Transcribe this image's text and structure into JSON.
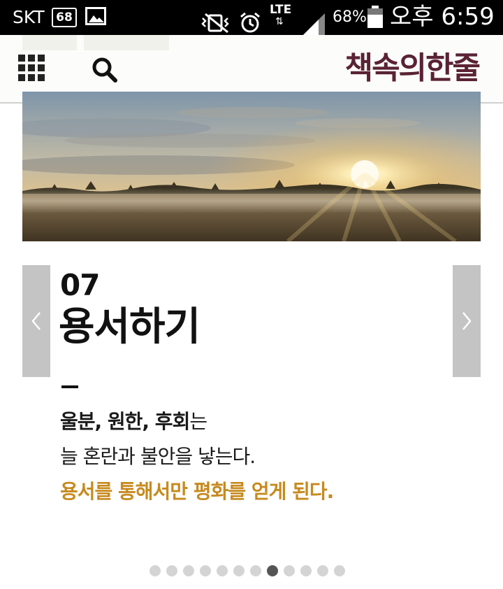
{
  "status_bar": {
    "carrier": "SKT",
    "notification_count": "68",
    "network": "LTE",
    "network_arrows": "⇅",
    "battery": "68%",
    "time": "오후 6:59"
  },
  "header": {
    "brand": "책속의한줄",
    "icons": [
      "grid-menu-icon",
      "search-icon"
    ],
    "brand_color": "#5a2235"
  },
  "slide": {
    "number": "07",
    "title": "용서하기",
    "lines": {
      "l1_bold": "울분, 원한, 후회",
      "l1_rest": "는",
      "l2": "늘 혼란과 불안을 낳는다.",
      "l3": "용서를 통해서만 평화를 얻게 된다."
    },
    "accent_color": "#c78a1e"
  },
  "pagination": {
    "total": 12,
    "active": 8
  }
}
